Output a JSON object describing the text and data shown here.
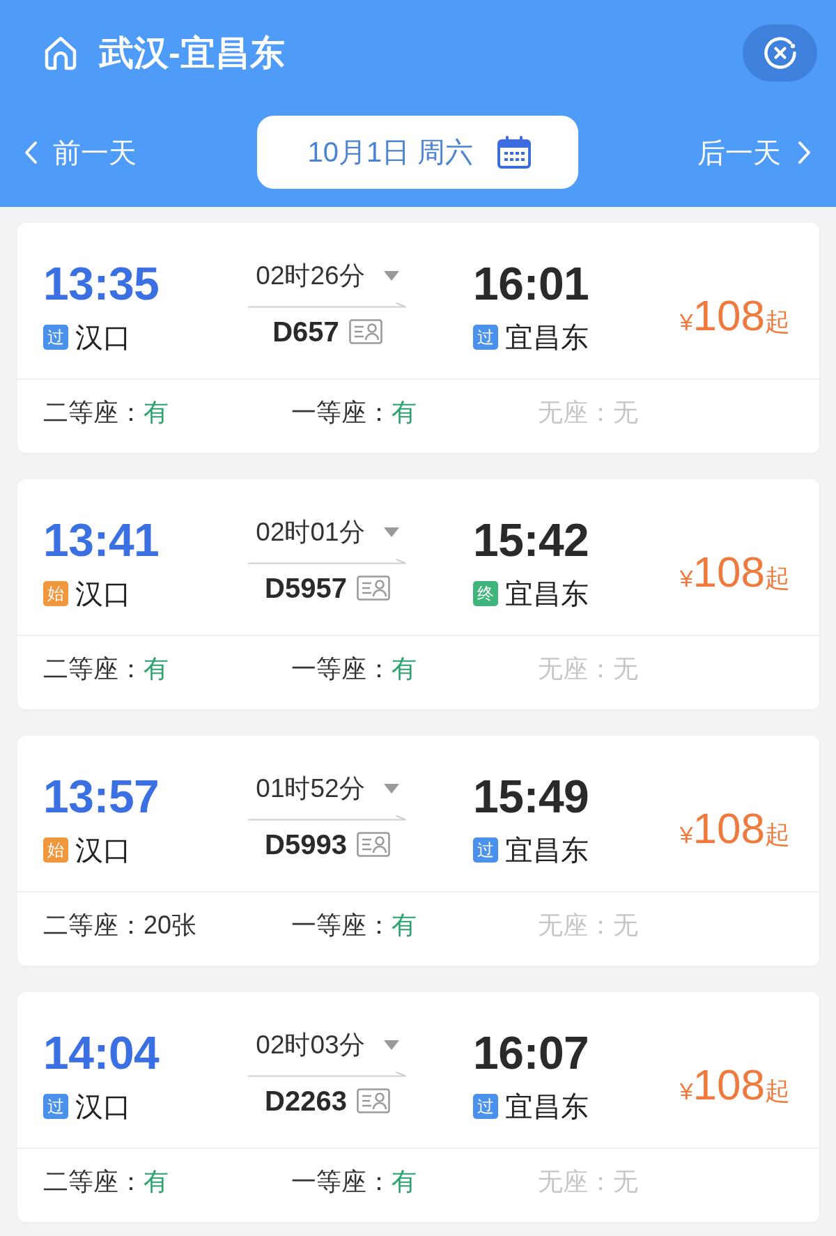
{
  "header": {
    "title": "武汉-宜昌东"
  },
  "date_bar": {
    "previous": "前一天",
    "date": "10月1日 周六",
    "next": "后一天"
  },
  "trains": [
    {
      "departure": {
        "time": "13:35",
        "badge": {
          "text": "过",
          "color": "#4a91ec"
        },
        "station": "汉口"
      },
      "duration": "02时26分",
      "train_number": "D657",
      "arrival": {
        "time": "16:01",
        "badge": {
          "text": "过",
          "color": "#4a91ec"
        },
        "station": "宜昌东"
      },
      "price": {
        "currency": "¥",
        "amount": "108",
        "suffix": "起"
      },
      "seats": [
        {
          "label": "二等座：",
          "value": "有",
          "kind": "plenty"
        },
        {
          "label": "一等座：",
          "value": "有",
          "kind": "plenty"
        },
        {
          "label": "无座：",
          "value": "无",
          "kind": "none"
        }
      ]
    },
    {
      "departure": {
        "time": "13:41",
        "badge": {
          "text": "始",
          "color": "#f0973d"
        },
        "station": "汉口"
      },
      "duration": "02时01分",
      "train_number": "D5957",
      "arrival": {
        "time": "15:42",
        "badge": {
          "text": "终",
          "color": "#3fb47b"
        },
        "station": "宜昌东"
      },
      "price": {
        "currency": "¥",
        "amount": "108",
        "suffix": "起"
      },
      "seats": [
        {
          "label": "二等座：",
          "value": "有",
          "kind": "plenty"
        },
        {
          "label": "一等座：",
          "value": "有",
          "kind": "plenty"
        },
        {
          "label": "无座：",
          "value": "无",
          "kind": "none"
        }
      ]
    },
    {
      "departure": {
        "time": "13:57",
        "badge": {
          "text": "始",
          "color": "#f0973d"
        },
        "station": "汉口"
      },
      "duration": "01时52分",
      "train_number": "D5993",
      "arrival": {
        "time": "15:49",
        "badge": {
          "text": "过",
          "color": "#4a91ec"
        },
        "station": "宜昌东"
      },
      "price": {
        "currency": "¥",
        "amount": "108",
        "suffix": "起"
      },
      "seats": [
        {
          "label": "二等座：",
          "value": "20张",
          "kind": "count"
        },
        {
          "label": "一等座：",
          "value": "有",
          "kind": "plenty"
        },
        {
          "label": "无座：",
          "value": "无",
          "kind": "none"
        }
      ]
    },
    {
      "departure": {
        "time": "14:04",
        "badge": {
          "text": "过",
          "color": "#4a91ec"
        },
        "station": "汉口"
      },
      "duration": "02时03分",
      "train_number": "D2263",
      "arrival": {
        "time": "16:07",
        "badge": {
          "text": "过",
          "color": "#4a91ec"
        },
        "station": "宜昌东"
      },
      "price": {
        "currency": "¥",
        "amount": "108",
        "suffix": "起"
      },
      "seats": [
        {
          "label": "二等座：",
          "value": "有",
          "kind": "plenty"
        },
        {
          "label": "一等座：",
          "value": "有",
          "kind": "plenty"
        },
        {
          "label": "无座：",
          "value": "无",
          "kind": "none"
        }
      ]
    }
  ]
}
